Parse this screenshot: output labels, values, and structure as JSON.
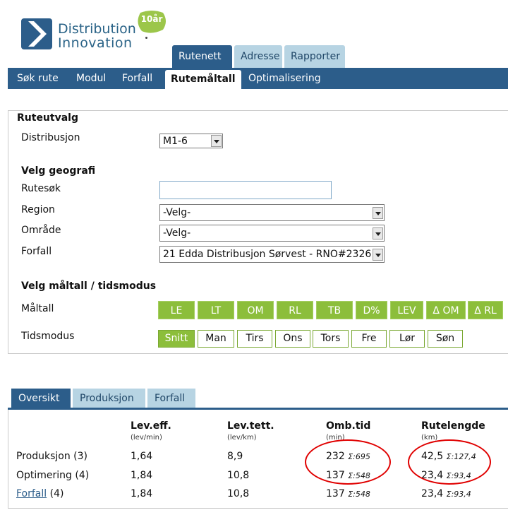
{
  "header": {
    "brand_line1": "Distribution",
    "brand_line2": "Innovation",
    "badge": "10år",
    "top_tabs": [
      "Rutenett",
      "Adresse",
      "Rapporter"
    ],
    "nav_items": [
      "Søk rute",
      "Modul",
      "Forfall",
      "Rutemåltall",
      "Optimalisering"
    ]
  },
  "form": {
    "section_title": "Ruteutvalg",
    "distribusjon_label": "Distribusjon",
    "distribusjon_value": "M1-6",
    "geo_title": "Velg geografi",
    "rutesok_label": "Rutesøk",
    "rutesok_value": "",
    "region_label": "Region",
    "region_value": "-Velg-",
    "omrade_label": "Område",
    "omrade_value": "-Velg-",
    "forfall_label": "Forfall",
    "forfall_value": "21 Edda Distribusjon Sørvest - RNO#2326",
    "maal_title": "Velg måltall / tidsmodus",
    "maaltall_label": "Måltall",
    "maaltall_buttons": [
      "LE",
      "LT",
      "OM",
      "RL",
      "TB",
      "D%",
      "LEV",
      "Δ OM",
      "Δ RL"
    ],
    "tidsmodus_label": "Tidsmodus",
    "tidsmodus_buttons": [
      "Snitt",
      "Man",
      "Tirs",
      "Ons",
      "Tors",
      "Fre",
      "Lør",
      "Søn"
    ]
  },
  "bottom_tabs": [
    "Oversikt",
    "Produksjon",
    "Forfall"
  ],
  "table": {
    "headers": [
      {
        "title": "Lev.eff.",
        "unit": "(lev/min)"
      },
      {
        "title": "Lev.tett.",
        "unit": "(lev/km)"
      },
      {
        "title": "Omb.tid",
        "unit": "(min)"
      },
      {
        "title": "Rutelengde",
        "unit": "(km)"
      }
    ],
    "rows": [
      {
        "label": "Produksjon",
        "count": "(3)",
        "eff": "1,64",
        "tett": "8,9",
        "omb": "232",
        "omb_sum": "Σ:695",
        "len": "42,5",
        "len_sum": "Σ:127,4"
      },
      {
        "label": "Optimering",
        "count": "(4)",
        "eff": "1,84",
        "tett": "10,8",
        "omb": "137",
        "omb_sum": "Σ:548",
        "len": "23,4",
        "len_sum": "Σ:93,4"
      },
      {
        "label": "Forfall",
        "count": "(4)",
        "eff": "1,84",
        "tett": "10,8",
        "omb": "137",
        "omb_sum": "Σ:548",
        "len": "23,4",
        "len_sum": "Σ:93,4"
      }
    ]
  },
  "colors": {
    "brand_blue": "#2c5d8a",
    "tab_light": "#b7d4e3",
    "green": "#8cbe3b",
    "highlight": "#e00000"
  }
}
